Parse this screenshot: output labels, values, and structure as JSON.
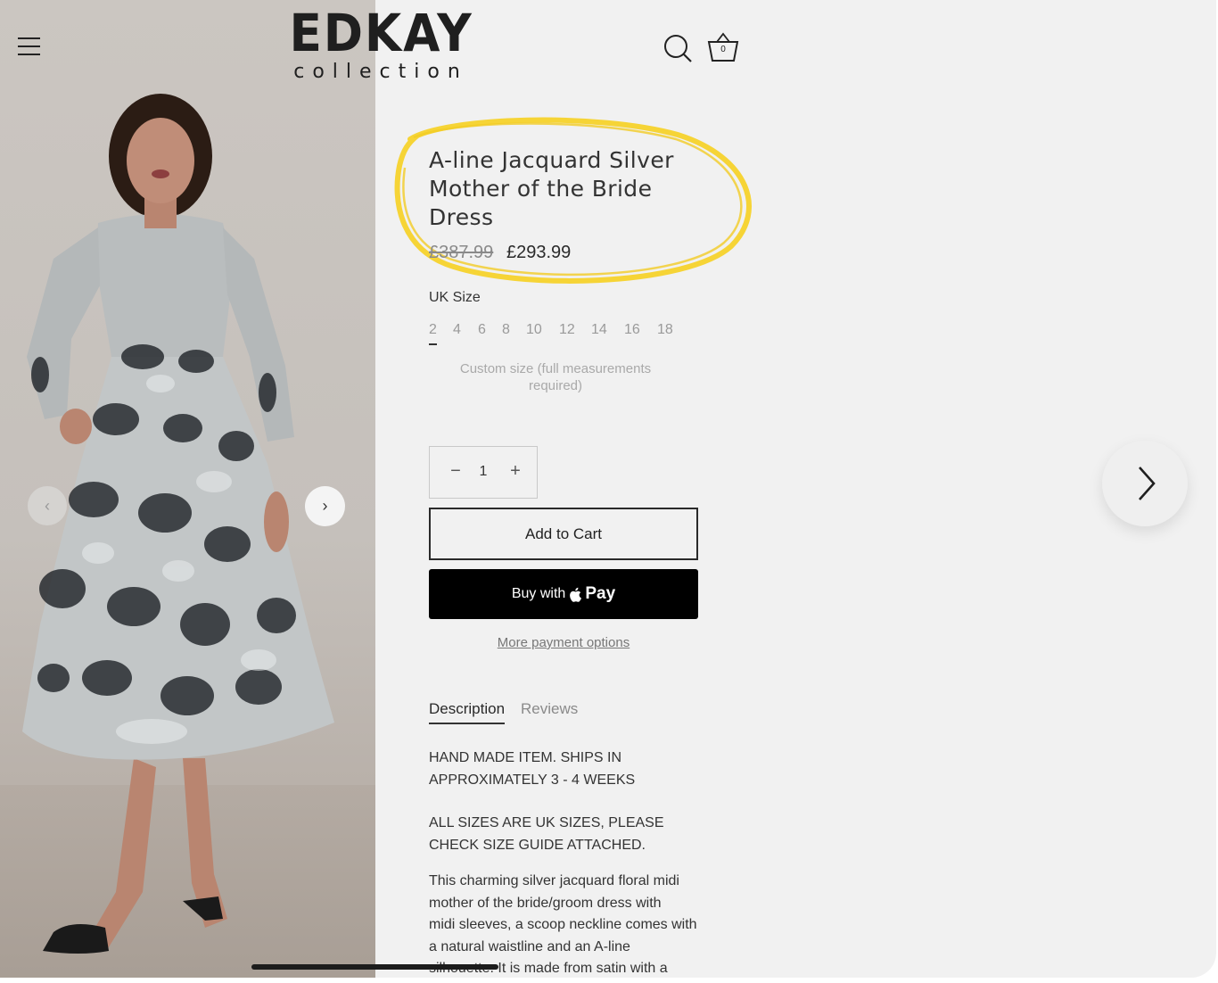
{
  "header": {
    "brand_main": "EDKAY",
    "brand_sub": "collection",
    "cart_count": "0"
  },
  "icons": {
    "menu": "hamburger-menu-icon",
    "search": "search-icon",
    "cart": "basket-icon",
    "gallery_prev": "chevron-left-icon",
    "gallery_next": "chevron-right-icon",
    "next_product": "chevron-right-icon"
  },
  "gallery": {
    "prev_glyph": "‹",
    "next_glyph": "›"
  },
  "product": {
    "title_lines": [
      "A-line Jacquard Silver",
      "Mother of the Bride",
      "Dress"
    ],
    "price_original": "£387.99",
    "price_sale": "£293.99",
    "highlight_color": "#f5d22b"
  },
  "size_selector": {
    "label": "UK Size",
    "options": [
      "2",
      "4",
      "6",
      "8",
      "10",
      "12",
      "14",
      "16",
      "18"
    ],
    "selected": "2",
    "custom_line1": "Custom size (full measurements",
    "custom_line2": "required)"
  },
  "quantity": {
    "minus": "−",
    "value": "1",
    "plus": "+"
  },
  "actions": {
    "add_to_cart": "Add to Cart",
    "buy_with": "Buy with",
    "pay": "Pay",
    "more_payment": "More payment options"
  },
  "tabs": [
    {
      "label": "Description",
      "active": true
    },
    {
      "label": "Reviews",
      "active": false
    }
  ],
  "description": {
    "p1_line1": "HAND MADE ITEM. SHIPS IN",
    "p1_line2": "APPROXIMATELY 3 - 4 WEEKS",
    "p2_line1": "ALL SIZES ARE UK SIZES, PLEASE",
    "p2_line2": "CHECK SIZE GUIDE ATTACHED.",
    "p3_line1": "This charming silver jacquard floral midi",
    "p3_line2": "mother of the bride/groom dress with",
    "p3_line3": "midi sleeves, a scoop neckline comes with",
    "p3_line4": "a natural waistline and an A-line",
    "p3_line5": "silhouette. It is made from satin with a"
  }
}
